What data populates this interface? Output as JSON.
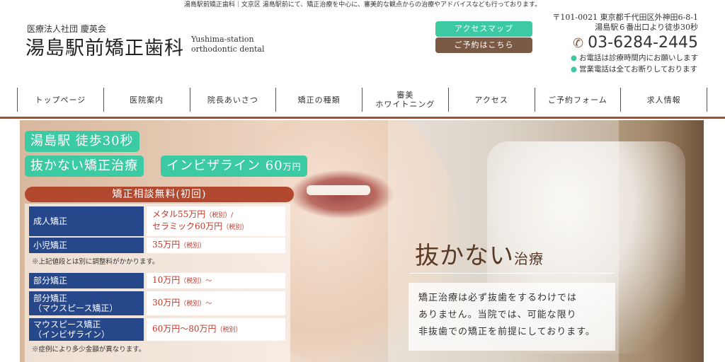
{
  "topline": "湯島駅前矯正歯科｜文京区 湯島駅前にて、矯正治療を中心に、審美的な観点からの治療やアドバイスなども行っております。",
  "logo": {
    "small": "医療法人社団 慶英会",
    "main": "湯島駅前矯正歯科",
    "en1": "Yushima-station",
    "en2": "orthodontic dental"
  },
  "header_buttons": {
    "access": "アクセスマップ",
    "reserve": "ご予約はこちら"
  },
  "address": {
    "line1": "〒101-0021 東京都千代田区外神田6-8-1",
    "line2": "湯島駅６番出口より徒歩30秒"
  },
  "tel": "03-6284-2445",
  "notes": [
    "お電話は診療時間内にお願いします",
    "営業電話は全てお断りしております"
  ],
  "nav": [
    "トップページ",
    "医院案内",
    "院長あいさつ",
    "矯正の種類",
    "審美",
    "ホワイトニング",
    "アクセス",
    "ご予約フォーム",
    "求人情報"
  ],
  "hero": {
    "badge1": "湯島駅 徒歩30秒",
    "badge2": "抜かない矯正治療",
    "badge3_main": "インビザライン 60",
    "badge3_unit": "万円",
    "consult": "矯正相談無料(初回)",
    "prices": [
      {
        "label": "成人矯正",
        "value1": "メタル55万円",
        "tax1": "（税別）/",
        "value2": "セラミック60万円",
        "tax2": "（税別）"
      },
      {
        "label": "小児矯正",
        "value1": "35万円",
        "tax1": "（税別）"
      },
      {
        "label": "部分矯正",
        "value1": "10万円",
        "tax1": "（税別）〜"
      },
      {
        "label": "部分矯正",
        "label2": "（マウスピース矯正）",
        "value1": "30万円",
        "tax1": "（税別）〜"
      },
      {
        "label": "マウスピース矯正",
        "label2": "（インビザライン）",
        "value1": "60万円〜80万円",
        "tax1": "（税別）"
      }
    ],
    "note1": "※上記値段とは別に調整料がかかります。",
    "note2": "※症例により多少金額が異なります。",
    "slogan_main": "抜かない",
    "slogan_small": "治療",
    "desc1": "矯正治療は必ず抜歯をするわけでは",
    "desc2": "ありません。当院では、可能な限り",
    "desc3": "非抜歯での矯正を前提にしております。"
  },
  "colors": {
    "accent": "#3ccaa3",
    "brown": "#7a5a44",
    "navy": "#26478a",
    "red": "#b2492f",
    "price": "#c0392b"
  }
}
